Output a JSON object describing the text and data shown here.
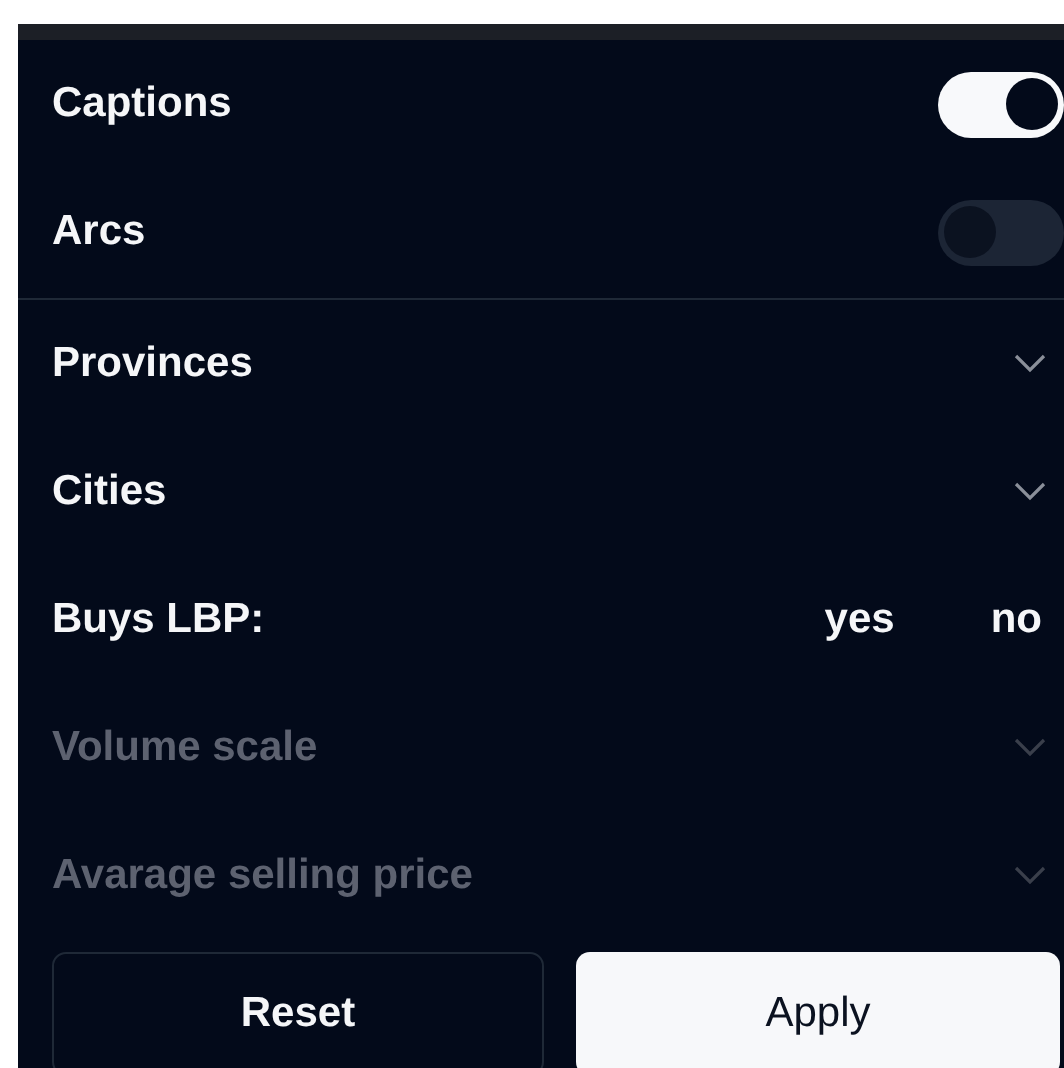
{
  "toggles": [
    {
      "label": "Captions",
      "on": true
    },
    {
      "label": "Arcs",
      "on": false
    }
  ],
  "filters": [
    {
      "kind": "dropdown",
      "label": "Provinces",
      "disabled": false
    },
    {
      "kind": "dropdown",
      "label": "Cities",
      "disabled": false
    },
    {
      "kind": "choice",
      "label": "Buys LBP:",
      "options": [
        "yes",
        "no"
      ]
    },
    {
      "kind": "dropdown",
      "label": "Volume scale",
      "disabled": true
    },
    {
      "kind": "dropdown",
      "label": "Avarage selling price",
      "disabled": true
    }
  ],
  "buttons": [
    {
      "label": "Reset",
      "kind": "secondary"
    },
    {
      "label": "Apply",
      "kind": "primary"
    }
  ]
}
